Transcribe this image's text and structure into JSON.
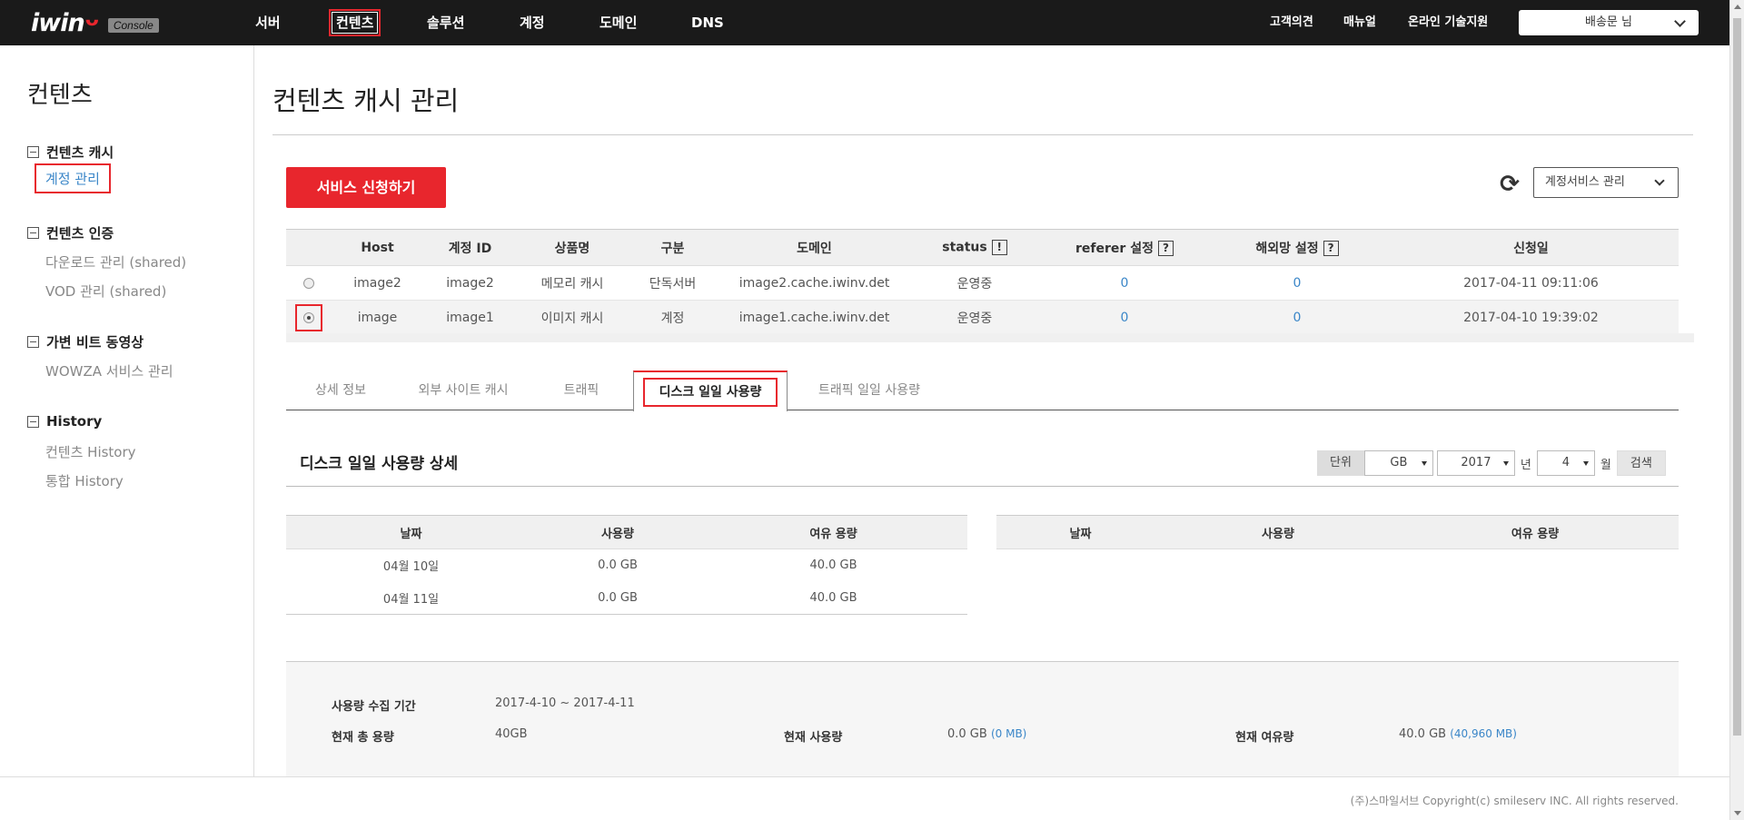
{
  "header": {
    "logo_text": "iwin",
    "logo_badge": "Console",
    "nav": [
      "서버",
      "컨텐츠",
      "솔루션",
      "계정",
      "도메인",
      "DNS"
    ],
    "active_nav": "컨텐츠",
    "right_links": [
      "고객의견",
      "매뉴얼",
      "온라인 기술지원"
    ],
    "user": "배송문 님"
  },
  "sidebar": {
    "title": "컨텐츠",
    "groups": [
      {
        "label": "컨텐츠 캐시",
        "items": [
          "계정 관리"
        ]
      },
      {
        "label": "컨텐츠 인증",
        "items": [
          "다운로드 관리 (shared)",
          "VOD 관리 (shared)"
        ]
      },
      {
        "label": "가변 비트 동영상",
        "items": [
          "WOWZA 서비스 관리"
        ]
      },
      {
        "label": "History",
        "items": [
          "컨텐츠 History",
          "통합 History"
        ]
      }
    ],
    "active_item": "계정 관리"
  },
  "main": {
    "title": "컨텐츠 캐시 관리",
    "apply_button": "서비스 신청하기",
    "service_select": "계정서비스 관리",
    "accounts": {
      "columns": [
        "",
        "Host",
        "계정 ID",
        "상품명",
        "구분",
        "도메인",
        "status",
        "referer 설정",
        "해외망 설정",
        "신청일"
      ],
      "help_marks": {
        "status": "!",
        "referer": "?",
        "overseas": "?"
      },
      "rows": [
        {
          "selected": false,
          "host": "image2",
          "id": "image2",
          "product": "메모리 캐시",
          "type": "단독서버",
          "domain": "image2.cache.iwinv.det",
          "status": "운영중",
          "referer": "0",
          "overseas": "0",
          "date": "2017-04-11 09:11:06"
        },
        {
          "selected": true,
          "host": "image",
          "id": "image1",
          "product": "이미지 캐시",
          "type": "계정",
          "domain": "image1.cache.iwinv.det",
          "status": "운영중",
          "referer": "0",
          "overseas": "0",
          "date": "2017-04-10 19:39:02"
        }
      ]
    },
    "tabs": [
      "상세 정보",
      "외부 사이트 캐시",
      "트래픽",
      "디스크 일일 사용량",
      "트래픽 일일 사용량"
    ],
    "active_tab": "디스크 일일 사용량",
    "detail": {
      "title": "디스크 일일 사용량 상세",
      "unit_label": "단위",
      "unit": "GB",
      "year": "2017",
      "year_suffix": "년",
      "month": "4",
      "month_suffix": "월",
      "search_button": "검색"
    },
    "usage": {
      "columns": [
        "날짜",
        "사용량",
        "여유 용량"
      ],
      "rows": [
        {
          "date": "04월 10일",
          "used": "0.0 GB",
          "free": "40.0 GB"
        },
        {
          "date": "04월 11일",
          "used": "0.0 GB",
          "free": "40.0 GB"
        }
      ]
    },
    "summary": {
      "period_label": "사용량 수집 기간",
      "period": "2017-4-10 ~ 2017-4-11",
      "total_label": "현재 총 용량",
      "total": "40GB",
      "used_label": "현재 사용량",
      "used": "0.0 GB",
      "used_mb": "(0 MB)",
      "free_label": "현재 여유량",
      "free": "40.0 GB",
      "free_mb": "(40,960 MB)"
    }
  },
  "footer": {
    "copyright": "(주)스마일서브 Copyright(c) smileserv INC. All rights reserved."
  },
  "colors": {
    "accent": "#e8262d",
    "link": "#3a86c8",
    "topbar": "#1a1a1a"
  }
}
